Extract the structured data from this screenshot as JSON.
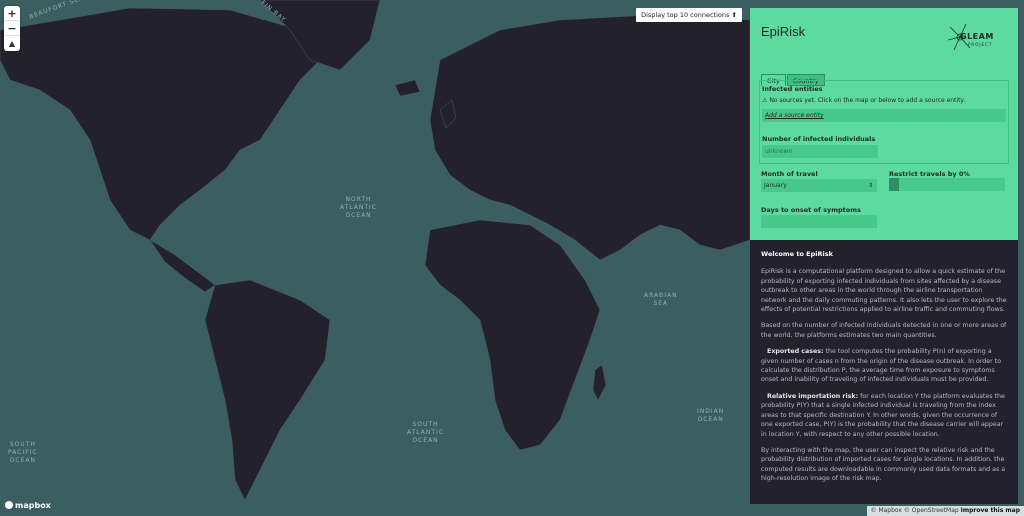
{
  "map": {
    "zoom_in": "+",
    "zoom_out": "−",
    "compass": "▲",
    "top_button": "Display top 10 connections ⬆",
    "labels": [
      {
        "key": "beaufort",
        "text": "BEAUFORT SEA"
      },
      {
        "key": "baffin",
        "text": "FIN BAY"
      },
      {
        "key": "north_atlantic",
        "text": "NORTH\nATLANTIC\nOCEAN"
      },
      {
        "key": "arabian",
        "text": "ARABIAN\nSEA"
      },
      {
        "key": "indian",
        "text": "INDIAN\nOCEAN"
      },
      {
        "key": "south_atlantic",
        "text": "SOUTH\nATLANTIC\nOCEAN"
      },
      {
        "key": "south_pacific",
        "text": "SOUTH\nPACIFIC\nOCEAN"
      }
    ],
    "mapbox_logo": "mapbox",
    "attribution_1": "© Mapbox © OpenStreetMap",
    "attribution_2": "Improve this map",
    "colors": {
      "water": "#3b5f61",
      "land": "#23222c"
    }
  },
  "panel": {
    "title": "EpiRisk",
    "logo_text": "GLEAM",
    "logo_sub": "PROJECT",
    "tabs": [
      {
        "label": "City",
        "active": true
      },
      {
        "label": "Country",
        "active": false
      }
    ],
    "infected_entities_label": "Infected entities",
    "no_sources_text": "No sources yet. Click on the map or below to add a source entity.",
    "add_source": "Add a source entity",
    "infected_individuals_label": "Number of infected individuals",
    "infected_individuals_placeholder": "unknown",
    "month_label": "Month of travel",
    "month_value": "January",
    "restrict_label": "Restrict travels by 0%",
    "restrict_value": 0,
    "days_label": "Days to onset of symptoms",
    "days_value": "",
    "color": "#5cdaa0"
  },
  "info": {
    "heading": "Welcome to EpiRisk",
    "p1": "EpiRisk is a computational platform designed to allow a quick estimate of the probability of exporting infected individuals from sites affected by a disease outbreak to other areas in the world through the airline transportation network and the daily commuting patterns. It also lets the user to explore the effects of potential restrictions applied to airline traffic and commuting flows.",
    "p2": "Based on the number of infected individuals detected in one or more areas of the world, the platforms estimates two main quantities.",
    "p3_title": "Exported cases:",
    "p3": " the tool computes the probability P(n) of exporting a given number of cases n from the origin of the disease outbreak. In order to calculate the distribution P, the average time from exposure to symptoms onset and inability of traveling of infected individuals must be provided.",
    "p4_title": "Relative importation risk:",
    "p4": " for each location Y the platform evaluates the probability P(Y) that a single infected individual is traveling from the index areas to that specific destination Y. In other words, given the occurrence of one exported case, P(Y) is the probability that the disease carrier will appear in location Y, with respect to any other possible location.",
    "p5": "By interacting with the map, the user can inspect the relative risk and the probability distribution of imported cases for single locations. In addition, the computed results are downloadable in commonly used data formats and as a high-resolution image of the risk map."
  }
}
